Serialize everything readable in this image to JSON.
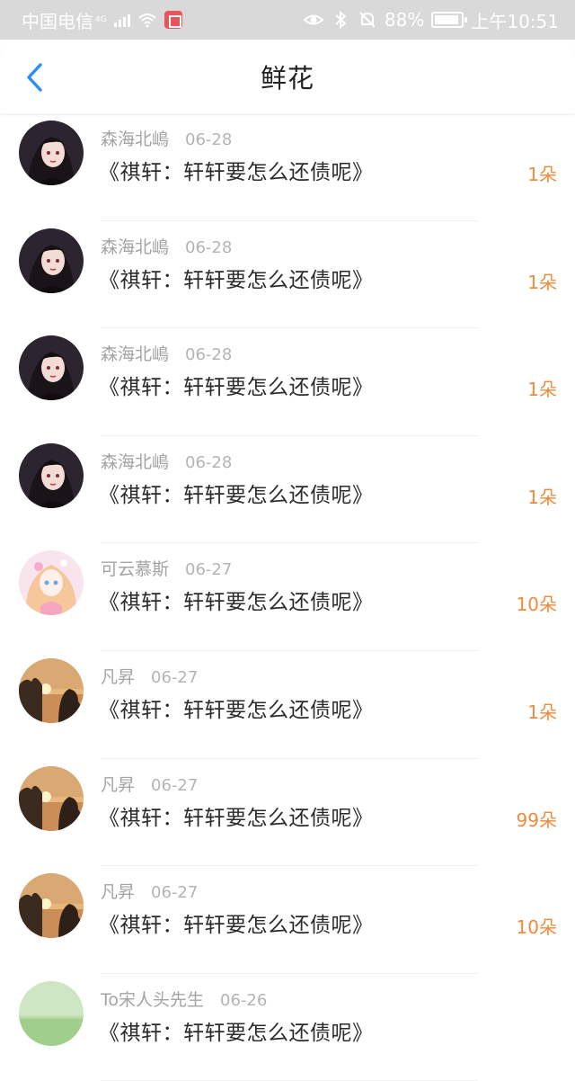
{
  "status_bar": {
    "carrier": "中国电信",
    "network": "4G",
    "battery": "88%",
    "time": "上午10:51",
    "battery_level": 0.88
  },
  "nav": {
    "title": "鲜花",
    "back_icon": "chevron-left-icon",
    "accent_color": "#2b8ef3"
  },
  "colors": {
    "count": "#f08a3c"
  },
  "items": [
    {
      "user": "森海北嶋",
      "date": "06-28",
      "book": "《祺轩：轩轩要怎么还债呢》",
      "count": "1朵",
      "avatar": "dark-girl"
    },
    {
      "user": "森海北嶋",
      "date": "06-28",
      "book": "《祺轩：轩轩要怎么还债呢》",
      "count": "1朵",
      "avatar": "dark-girl"
    },
    {
      "user": "森海北嶋",
      "date": "06-28",
      "book": "《祺轩：轩轩要怎么还债呢》",
      "count": "1朵",
      "avatar": "dark-girl"
    },
    {
      "user": "森海北嶋",
      "date": "06-28",
      "book": "《祺轩：轩轩要怎么还债呢》",
      "count": "1朵",
      "avatar": "dark-girl"
    },
    {
      "user": "可云慕斯",
      "date": "06-27",
      "book": "《祺轩：轩轩要怎么还债呢》",
      "count": "10朵",
      "avatar": "pink-girl"
    },
    {
      "user": "凡昇",
      "date": "06-27",
      "book": "《祺轩：轩轩要怎么还债呢》",
      "count": "1朵",
      "avatar": "sunset"
    },
    {
      "user": "凡昇",
      "date": "06-27",
      "book": "《祺轩：轩轩要怎么还债呢》",
      "count": "99朵",
      "avatar": "sunset"
    },
    {
      "user": "凡昇",
      "date": "06-27",
      "book": "《祺轩：轩轩要怎么还债呢》",
      "count": "10朵",
      "avatar": "sunset"
    },
    {
      "user": "To宋人头先生",
      "date": "06-26",
      "book": "《祺轩：轩轩要怎么还债呢》",
      "count": "",
      "avatar": "green-field"
    }
  ]
}
